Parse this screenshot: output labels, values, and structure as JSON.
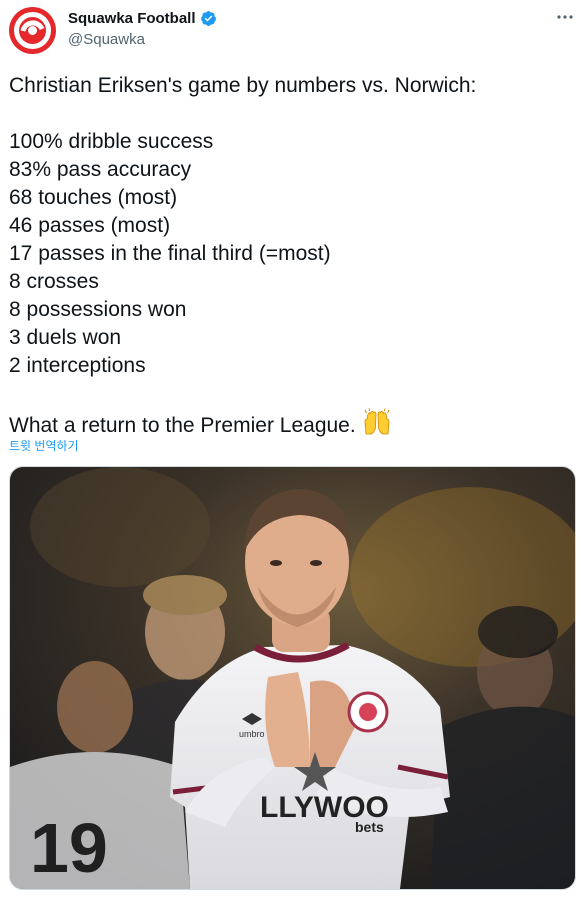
{
  "account": {
    "display_name": "Squawka Football",
    "handle": "@Squawka",
    "verified": true,
    "avatar_color": "#e4282c"
  },
  "tweet": {
    "headline": "Christian Eriksen's game by numbers vs. Norwich:",
    "stats": [
      "100% dribble success",
      "83% pass accuracy",
      "68 touches (most)",
      "46 passes (most)",
      "17 passes in the final third (=most)",
      "8 crosses",
      "8 possessions won",
      "3 duels won",
      "2 interceptions"
    ],
    "closing": "What a return to the Premier League.",
    "emoji": "raised-hands"
  },
  "translate_label": "트윗 번역하기",
  "media": {
    "description_icon": "player-photo",
    "shirt_text": "LLYWOO",
    "sponsor_small": "bets",
    "brand": "umbro",
    "back_number": "19"
  },
  "colors": {
    "link": "#1d9bf0",
    "verified": "#1d9bf0",
    "handle": "#536471"
  }
}
